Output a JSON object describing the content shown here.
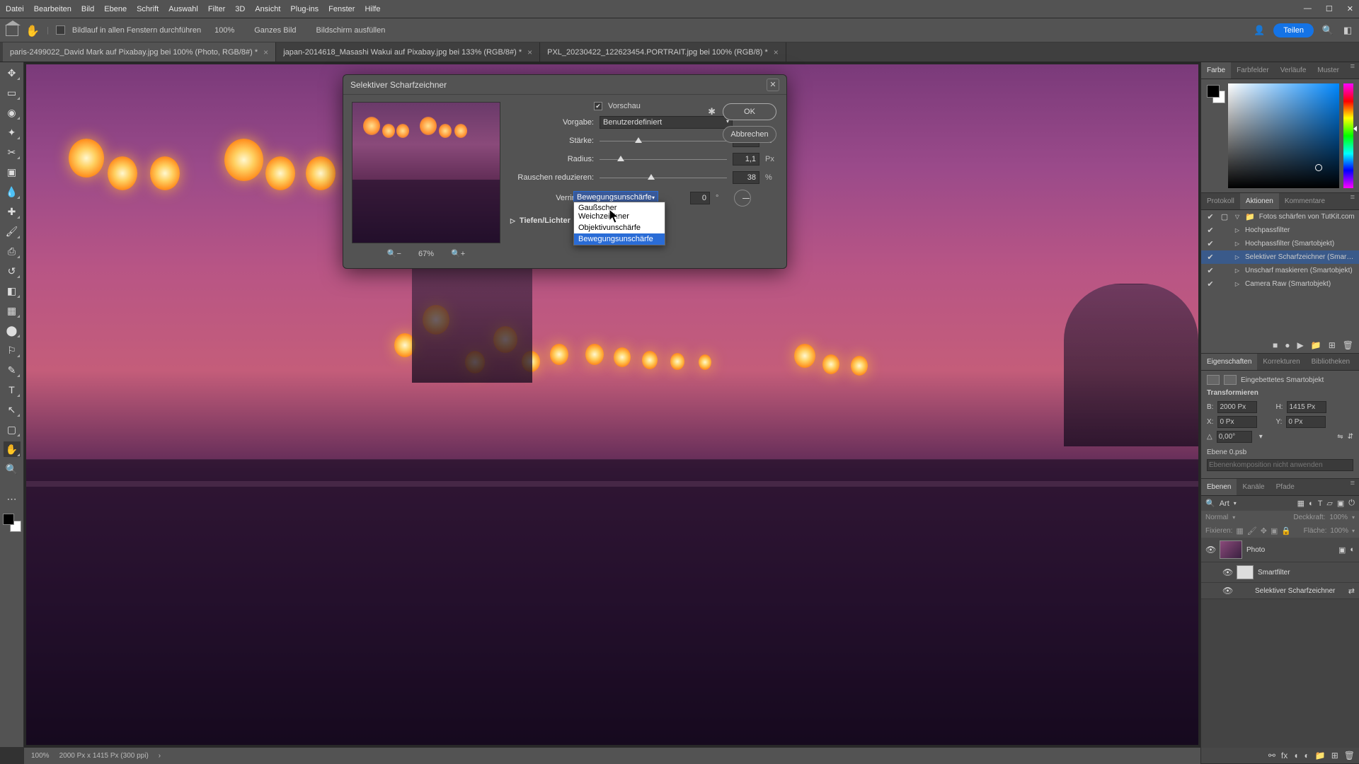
{
  "menubar": {
    "items": [
      "Datei",
      "Bearbeiten",
      "Bild",
      "Ebene",
      "Schrift",
      "Auswahl",
      "Filter",
      "3D",
      "Ansicht",
      "Plug-ins",
      "Fenster",
      "Hilfe"
    ]
  },
  "optbar": {
    "scroll_all": "Bildlauf in allen Fenstern durchführen",
    "zoom": "100%",
    "fit": "Ganzes Bild",
    "fill": "Bildschirm ausfüllen",
    "share": "Teilen"
  },
  "tabs": [
    {
      "label": "paris-2499022_David Mark auf Pixabay.jpg bei 100% (Photo, RGB/8#) *",
      "active": true
    },
    {
      "label": "japan-2014618_Masashi Wakui auf Pixabay.jpg bei 133% (RGB/8#) *",
      "active": false
    },
    {
      "label": "PXL_20230422_122623454.PORTRAIT.jpg bei 100% (RGB/8) *",
      "active": false
    }
  ],
  "dialog": {
    "title": "Selektiver Scharfzeichner",
    "preview": "Vorschau",
    "ok": "OK",
    "cancel": "Abbrechen",
    "preset_label": "Vorgabe:",
    "preset_value": "Benutzerdefiniert",
    "amount_label": "Stärke:",
    "amount_value": "145",
    "amount_unit": "%",
    "radius_label": "Radius:",
    "radius_value": "1,1",
    "radius_unit": "Px",
    "noise_label": "Rauschen reduzieren:",
    "noise_value": "38",
    "noise_unit": "%",
    "remove_label": "Verringern:",
    "remove_value": "Bewegungsunschärfe",
    "angle_value": "0",
    "angle_unit": "°",
    "section": "Tiefen/Lichter",
    "zoom": "67%",
    "dd_options": [
      "Gaußscher Weichzeichner",
      "Objektivunschärfe",
      "Bewegungsunschärfe"
    ]
  },
  "right": {
    "color_tabs": [
      "Farbe",
      "Farbfelder",
      "Verläufe",
      "Muster"
    ],
    "hist_tabs": [
      "Protokoll",
      "Aktionen",
      "Kommentare"
    ],
    "action_set": "Fotos schärfen von TutKit.com",
    "actions": [
      "Hochpassfilter",
      "Hochpassfilter (Smartobjekt)",
      "Selektiver Scharfzeichner (Smarto…",
      "Unscharf maskieren (Smartobjekt)",
      "Camera Raw (Smartobjekt)"
    ],
    "prop_tabs": [
      "Eigenschaften",
      "Korrekturen",
      "Bibliotheken"
    ],
    "prop_kind": "Eingebettetes Smartobjekt",
    "transform": "Transformieren",
    "w_label": "B:",
    "w_value": "2000 Px",
    "h_label": "H:",
    "h_value": "1415 Px",
    "x_label": "X:",
    "x_value": "0 Px",
    "y_label": "Y:",
    "y_value": "0 Px",
    "angle_value": "0,00°",
    "layer_file": "Ebene 0.psb",
    "comp_placeholder": "Ebenenkomposition nicht anwenden",
    "layer_tabs": [
      "Ebenen",
      "Kanäle",
      "Pfade"
    ],
    "search_kind": "Art",
    "search_placeholder": "",
    "blend": "Normal",
    "opacity_label": "Deckkraft:",
    "opacity": "100%",
    "fix": "Fixieren:",
    "fill_label": "Fläche:",
    "fill": "100%",
    "layers": [
      {
        "name": "Photo",
        "smart": true
      },
      {
        "name": "Smartfilter",
        "sub": true
      },
      {
        "name": "Selektiver Scharfzeichner",
        "sub": true,
        "fx": true
      }
    ]
  },
  "status": {
    "zoom": "100%",
    "dims": "2000 Px x 1415 Px (300 ppi)"
  }
}
